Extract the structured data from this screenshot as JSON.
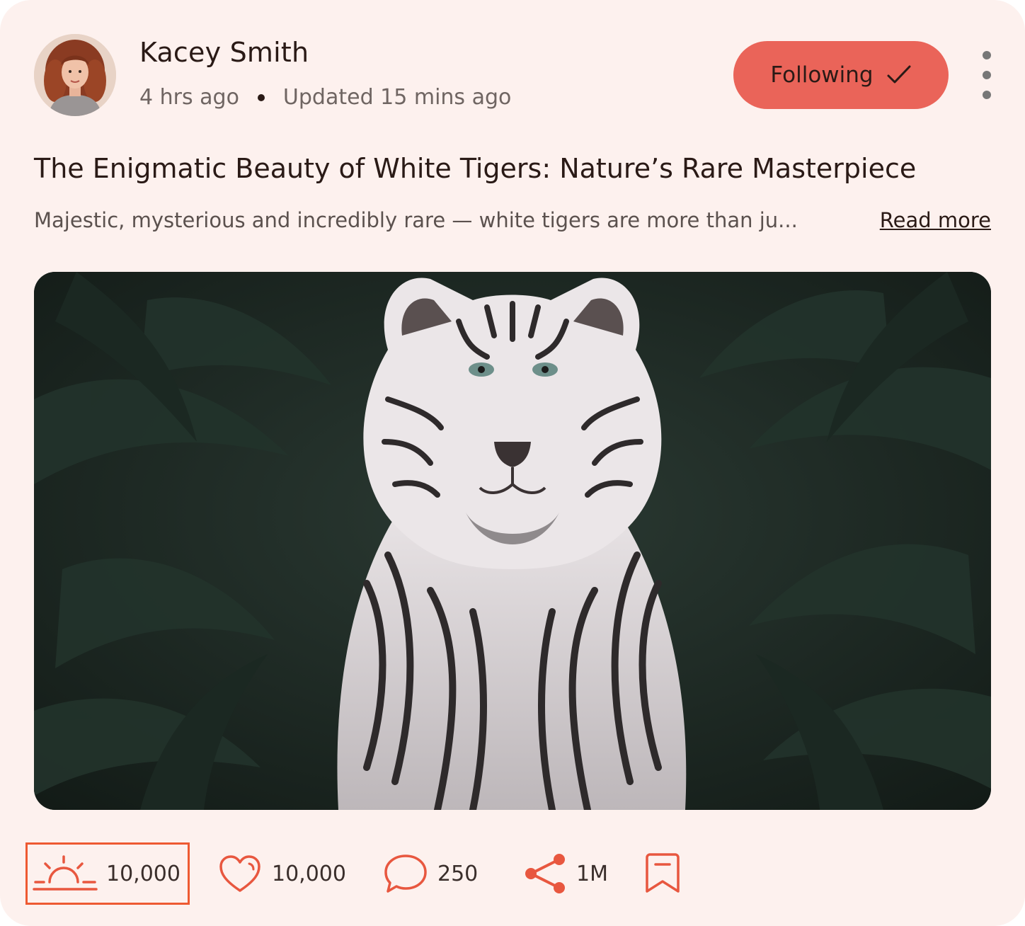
{
  "post": {
    "author": {
      "name": "Kacey Smith",
      "avatar_icon": "avatar-photo"
    },
    "posted_ago": "4 hrs ago",
    "updated": "Updated 15 mins ago",
    "follow_button": {
      "label": "Following",
      "icon": "check-icon"
    },
    "more_icon": "more-vertical-icon",
    "title": "The Enigmatic Beauty of White Tigers: Nature’s Rare Masterpiece",
    "excerpt": "Majestic, mysterious and incredibly rare — white tigers are more than ju...",
    "read_more": "Read more",
    "image_description_icon": "white-tiger-photo",
    "stats": {
      "sunrise": {
        "icon": "sunrise-icon",
        "count": "10,000"
      },
      "likes": {
        "icon": "heart-icon",
        "count": "10,000"
      },
      "comments": {
        "icon": "comment-icon",
        "count": "250"
      },
      "shares": {
        "icon": "share-icon",
        "count": "1M"
      },
      "bookmark": {
        "icon": "bookmark-icon"
      }
    }
  },
  "colors": {
    "card_background": "#fdf1ee",
    "accent": "#ea6459",
    "icon_accent": "#e8573f",
    "highlight_border": "#ee5a32",
    "text_primary": "#2a1a16",
    "text_muted": "#6f6562"
  }
}
